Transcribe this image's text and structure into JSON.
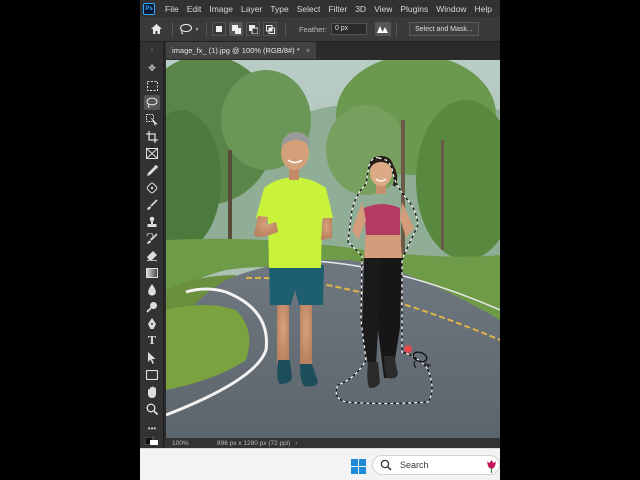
{
  "menubar": {
    "logo": "Ps",
    "items": [
      "File",
      "Edit",
      "Image",
      "Layer",
      "Type",
      "Select",
      "Filter",
      "3D",
      "View",
      "Plugins",
      "Window",
      "Help"
    ]
  },
  "options": {
    "home_icon": "home-icon",
    "lasso_icon": "lasso-icon",
    "feather_label": "Feather:",
    "feather_value": "0 px",
    "select_mask_label": "Select and Mask..."
  },
  "document": {
    "tab_title": "image_fx_ (1).jpg @ 100% (RGB/8#) *",
    "tab_close": "×"
  },
  "status": {
    "zoom": "100%",
    "doc_size": "896 px x 1280 px (72 ppi)",
    "arrow": "›"
  },
  "taskbar": {
    "search_label": "Search"
  },
  "colors": {
    "accent": "#31a8ff",
    "windows_blue": "#1c8ad8"
  },
  "tools": [
    "move-tool-icon",
    "marquee-tool-icon",
    "lasso-tool-icon",
    "object-select-tool-icon",
    "crop-tool-icon",
    "frame-tool-icon",
    "eyedropper-tool-icon",
    "healing-brush-icon",
    "brush-tool-icon",
    "clone-stamp-icon",
    "history-brush-icon",
    "eraser-tool-icon",
    "gradient-tool-icon",
    "blur-tool-icon",
    "dodge-tool-icon",
    "pen-tool-icon",
    "type-tool-icon",
    "path-select-icon",
    "shape-tool-icon",
    "hand-tool-icon",
    "zoom-tool-icon",
    "more-tools-icon"
  ]
}
